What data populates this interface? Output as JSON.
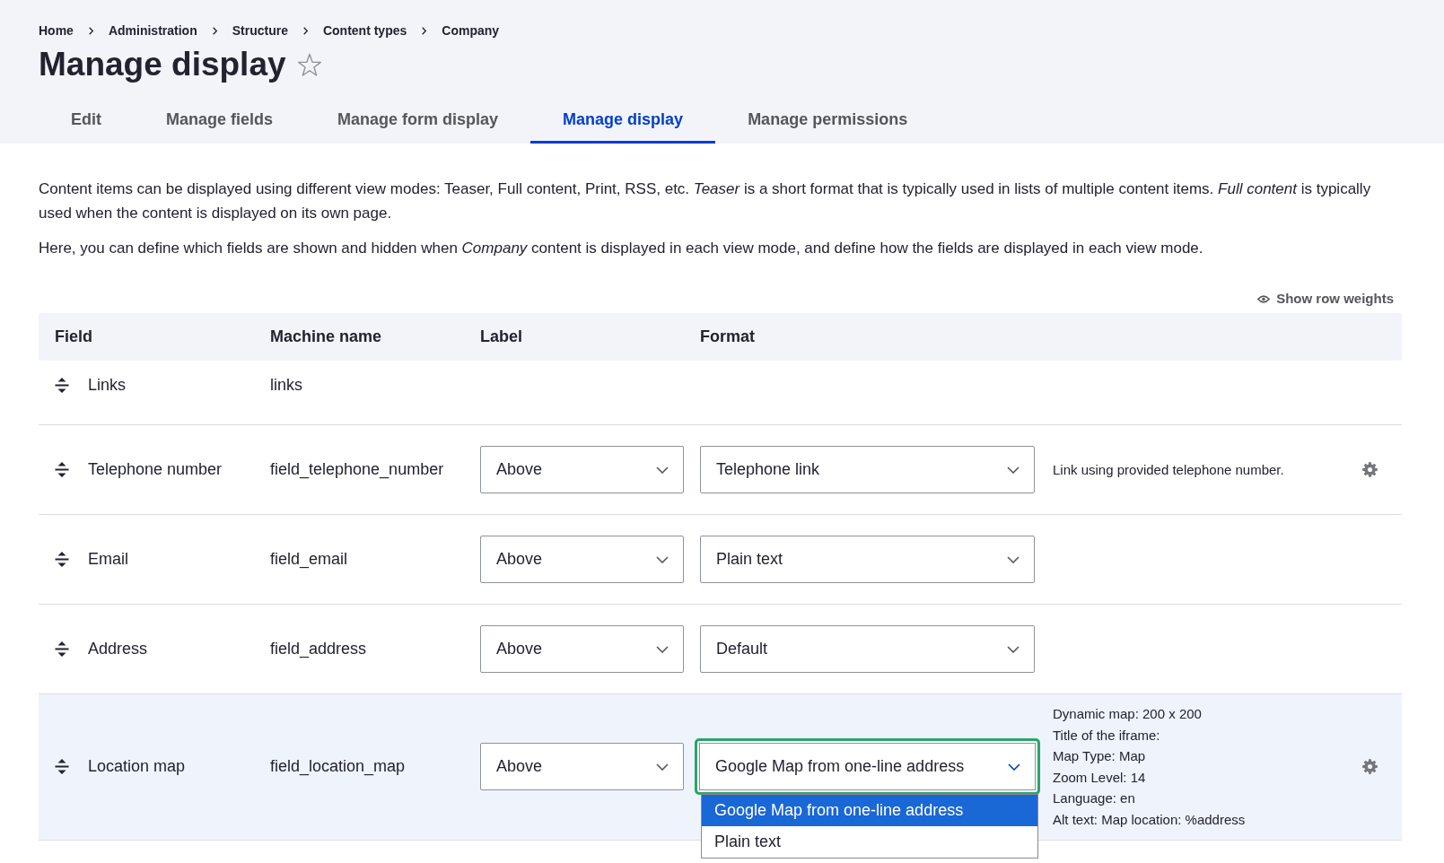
{
  "breadcrumb": [
    "Home",
    "Administration",
    "Structure",
    "Content types",
    "Company"
  ],
  "page_title": "Manage display",
  "tabs": [
    {
      "label": "Edit",
      "selected": false
    },
    {
      "label": "Manage fields",
      "selected": false
    },
    {
      "label": "Manage form display",
      "selected": false
    },
    {
      "label": "Manage display",
      "selected": true
    },
    {
      "label": "Manage permissions",
      "selected": false
    }
  ],
  "description": [
    "Content items can be displayed using different view modes: Teaser, Full content, Print, RSS, etc. *Teaser* is a short format that is typically used in lists of multiple content items. *Full content* is typically used when the content is displayed on its own page.",
    "Here, you can define which fields are shown and hidden when *Company* content is displayed in each view mode, and define how the fields are displayed in each view mode."
  ],
  "show_row_weights": "Show row weights",
  "table": {
    "columns": [
      "Field",
      "Machine name",
      "Label",
      "Format"
    ],
    "rows": [
      {
        "field": "Links",
        "machine_name": "links",
        "highlighted": false,
        "settings": false
      },
      {
        "field": "Telephone number",
        "machine_name": "field_telephone_number",
        "label": "Above",
        "format": {
          "value": "Telephone link",
          "open": false
        },
        "summary": [
          "Link using provided telephone number."
        ],
        "highlighted": false,
        "settings": true
      },
      {
        "field": "Email",
        "machine_name": "field_email",
        "label": "Above",
        "format": {
          "value": "Plain text",
          "open": false
        },
        "highlighted": false,
        "settings": false
      },
      {
        "field": "Address",
        "machine_name": "field_address",
        "label": "Above",
        "format": {
          "value": "Default",
          "open": false
        },
        "highlighted": false,
        "settings": false
      },
      {
        "field": "Location map",
        "machine_name": "field_location_map",
        "label": "Above",
        "format": {
          "value": "Google Map from one-line address",
          "open": true,
          "options": [
            {
              "label": "Google Map from one-line address",
              "selected": true
            },
            {
              "label": "Plain text",
              "selected": false
            }
          ]
        },
        "summary": [
          "Dynamic map: 200 x 200",
          "Title of the iframe:",
          "Map Type: Map",
          "Zoom Level: 14",
          "Language: en",
          "Alt text: Map location: %address"
        ],
        "highlighted": true,
        "settings": true
      }
    ]
  }
}
